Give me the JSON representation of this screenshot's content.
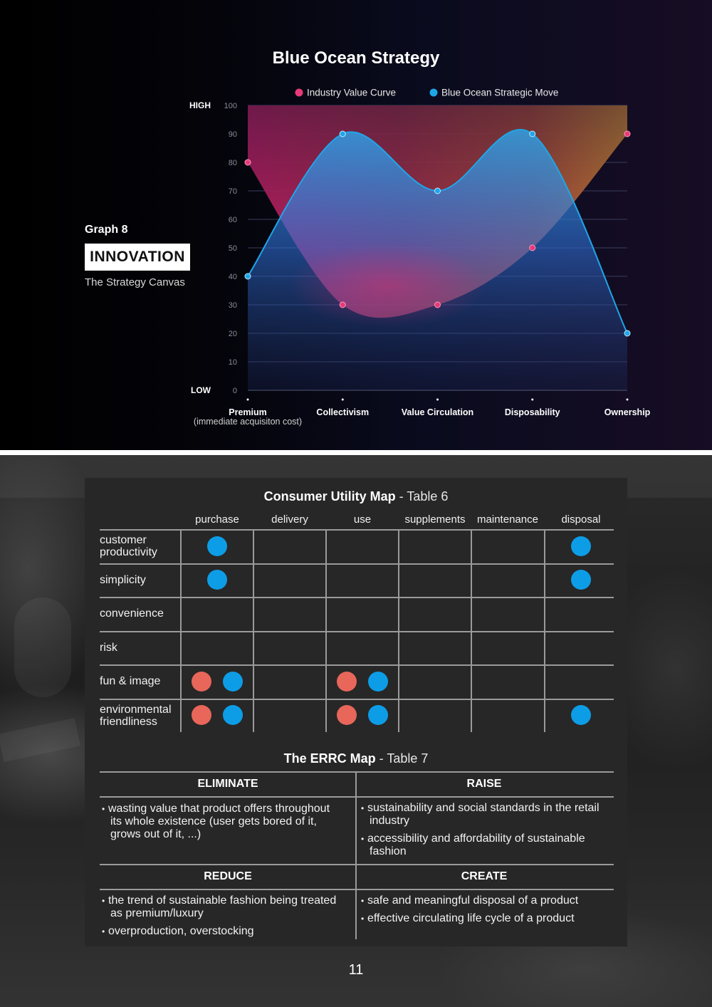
{
  "side": {
    "graph_label": "Graph 8",
    "box_label": "INNOVATION",
    "subtitle": "The Strategy Canvas"
  },
  "chart_data": {
    "type": "line",
    "title": "Blue Ocean Strategy",
    "categories": [
      "Premium",
      "Collectivism",
      "Value Circulation",
      "Disposability",
      "Ownership"
    ],
    "category_sublabels": [
      "(immediate acquisiton cost)",
      "",
      "",
      "",
      ""
    ],
    "series": [
      {
        "name": "Industry Value Curve",
        "values": [
          80,
          30,
          30,
          50,
          90
        ],
        "color": "#e8397a"
      },
      {
        "name": "Blue Ocean Strategic Move",
        "values": [
          40,
          90,
          70,
          90,
          20
        ],
        "color": "#1fa6e8"
      }
    ],
    "ylim": [
      0,
      100
    ],
    "yticks": [
      0,
      10,
      20,
      30,
      40,
      50,
      60,
      70,
      80,
      90,
      100
    ],
    "y_high_label": "HIGH",
    "y_low_label": "LOW",
    "grid": true,
    "legend_position": "top"
  },
  "utility_map": {
    "title": "Consumer Utility Map",
    "subtitle": "- Table 6",
    "columns": [
      "purchase",
      "delivery",
      "use",
      "supplements",
      "maintenance",
      "disposal"
    ],
    "rows": [
      {
        "label": "customer productivity",
        "label_lines": [
          "customer",
          "productivity"
        ],
        "cells": [
          [
            "blue"
          ],
          [],
          [],
          [],
          [],
          [
            "blue"
          ]
        ]
      },
      {
        "label": "simplicity",
        "label_lines": [
          "simplicity"
        ],
        "cells": [
          [
            "blue"
          ],
          [],
          [],
          [],
          [],
          [
            "blue"
          ]
        ]
      },
      {
        "label": "convenience",
        "label_lines": [
          "convenience"
        ],
        "cells": [
          [],
          [],
          [],
          [],
          [],
          []
        ]
      },
      {
        "label": "risk",
        "label_lines": [
          "risk"
        ],
        "cells": [
          [],
          [],
          [],
          [],
          [],
          []
        ]
      },
      {
        "label": "fun & image",
        "label_lines": [
          "fun & image"
        ],
        "cells": [
          [
            "red",
            "blue"
          ],
          [],
          [
            "red",
            "blue"
          ],
          [],
          [],
          []
        ]
      },
      {
        "label": "environmental friendliness",
        "label_lines": [
          "environmental",
          "friendliness"
        ],
        "cells": [
          [
            "red",
            "blue"
          ],
          [],
          [
            "red",
            "blue"
          ],
          [],
          [],
          [
            "blue"
          ]
        ]
      }
    ],
    "dot_colors": {
      "blue": "#0d9de6",
      "red": "#e8665a"
    }
  },
  "errc": {
    "title": "The ERRC Map",
    "subtitle": "- Table 7",
    "eliminate": {
      "heading": "ELIMINATE",
      "items": [
        [
          "wasting value that product offers throughout",
          "its whole existence (user gets bored of it,",
          "grows out of it, ...)"
        ]
      ]
    },
    "raise": {
      "heading": "RAISE",
      "items": [
        [
          "sustainability and social standards in the retail",
          "industry"
        ],
        [
          "accessibility and affordability of sustainable",
          "fashion"
        ]
      ]
    },
    "reduce": {
      "heading": "REDUCE",
      "items": [
        [
          "the trend of sustainable fashion being treated",
          "as premium/luxury"
        ],
        [
          "overproduction, overstocking"
        ]
      ]
    },
    "create": {
      "heading": "CREATE",
      "items": [
        [
          "safe and meaningful disposal of a product"
        ],
        [
          "effective circulating life cycle of a product"
        ]
      ]
    }
  },
  "page_number": "11"
}
